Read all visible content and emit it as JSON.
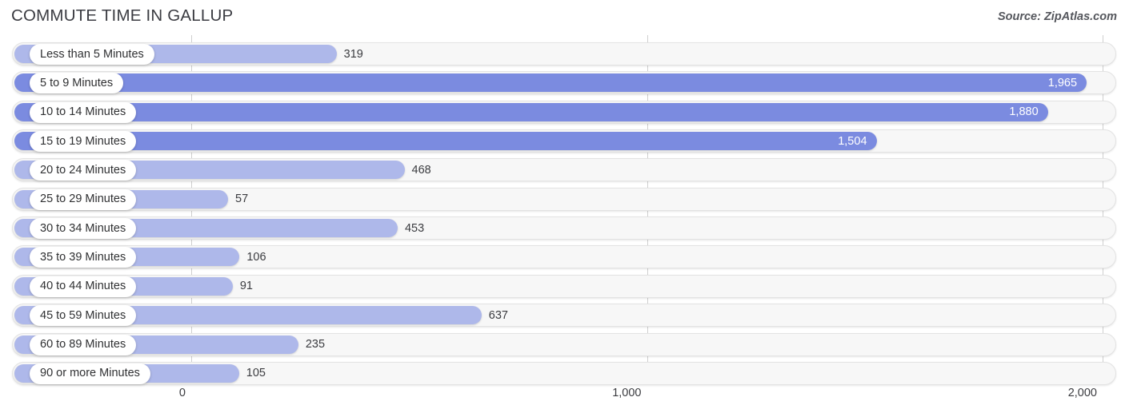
{
  "header": {
    "title": "COMMUTE TIME IN GALLUP",
    "source": "Source: ZipAtlas.com"
  },
  "colors": {
    "bar_light": "#aeb8ea",
    "bar_dark": "#7b8be0",
    "track": "#f7f7f7",
    "track_border": "#e3e3e3",
    "gridline": "#cfcfcf",
    "text": "#2f3032"
  },
  "chart_data": {
    "type": "bar",
    "orientation": "horizontal",
    "title": "COMMUTE TIME IN GALLUP",
    "xlabel": "",
    "ylabel": "",
    "xlim": [
      0,
      2000
    ],
    "grid": true,
    "legend": "none",
    "source": "Source: ZipAtlas.com",
    "tick_labels": [
      "0",
      "1,000",
      "2,000"
    ],
    "tick_values": [
      0,
      1000,
      2000
    ],
    "categories": [
      "Less than 5 Minutes",
      "5 to 9 Minutes",
      "10 to 14 Minutes",
      "15 to 19 Minutes",
      "20 to 24 Minutes",
      "25 to 29 Minutes",
      "30 to 34 Minutes",
      "35 to 39 Minutes",
      "40 to 44 Minutes",
      "45 to 59 Minutes",
      "60 to 89 Minutes",
      "90 or more Minutes"
    ],
    "values": [
      319,
      1965,
      1880,
      1504,
      468,
      57,
      453,
      106,
      91,
      637,
      235,
      105
    ],
    "value_labels": [
      "319",
      "1,965",
      "1,880",
      "1,504",
      "468",
      "57",
      "453",
      "106",
      "91",
      "637",
      "235",
      "105"
    ],
    "label_placement": [
      "outside",
      "inside",
      "inside",
      "inside",
      "outside",
      "outside",
      "outside",
      "outside",
      "outside",
      "outside",
      "outside",
      "outside"
    ],
    "bar_shade": [
      "light",
      "dark",
      "dark",
      "dark",
      "light",
      "light",
      "light",
      "light",
      "light",
      "light",
      "light",
      "light"
    ]
  }
}
